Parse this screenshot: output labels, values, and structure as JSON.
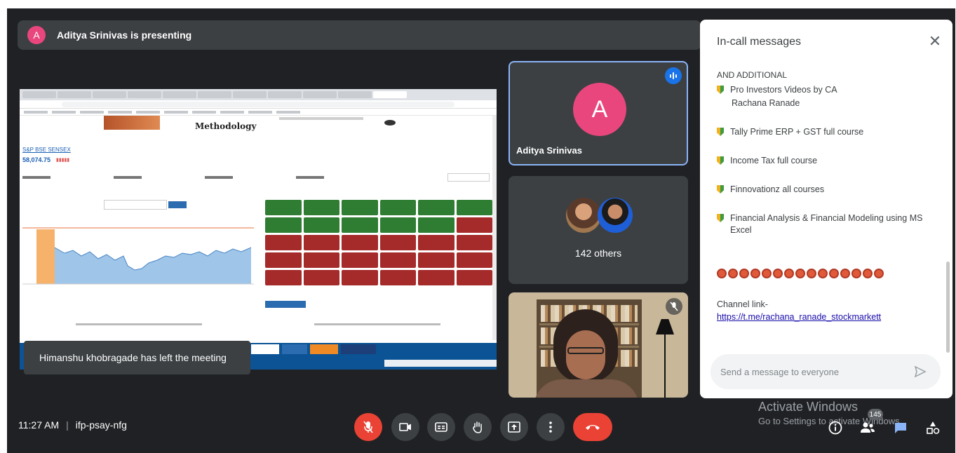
{
  "presenting": {
    "avatar_initial": "A",
    "text": "Aditya Srinivas is presenting"
  },
  "shared_screen": {
    "heading": "Methodology",
    "index_title": "S&P BSE SENSEX",
    "index_value": "58,074.75"
  },
  "toast": {
    "text": "Himanshu khobragade has left the meeting"
  },
  "tiles": {
    "presenter": {
      "initial": "A",
      "name": "Aditya Srinivas"
    },
    "group": {
      "label": "142 others"
    }
  },
  "chat": {
    "title": "In-call messages",
    "messages": {
      "heading": "AND ADDITIONAL",
      "line1a": "Pro Investors Videos by CA",
      "line1b": "Rachana Ranade",
      "line2": "Tally Prime ERP + GST full course",
      "line3": "Income Tax full course",
      "line4": "Finnovationz all courses",
      "line5": "Financial Analysis & Financial Modeling using MS Excel",
      "channel_label": "Channel link-",
      "channel_url": "https://t.me/rachana_ranade_stockmarkett"
    },
    "input_placeholder": "Send a message to everyone"
  },
  "bottom_bar": {
    "time": "11:27 AM",
    "separator": "|",
    "meeting_code": "ifp-psay-nfg",
    "people_count": "145"
  },
  "windows_watermark": {
    "title": "Activate Windows",
    "subtitle": "Go to Settings to activate Windows."
  },
  "colors": {
    "accent_blue": "#1a73e8",
    "end_call_red": "#ea4335",
    "avatar_pink": "#e8467c",
    "dark_bg": "#202124"
  }
}
